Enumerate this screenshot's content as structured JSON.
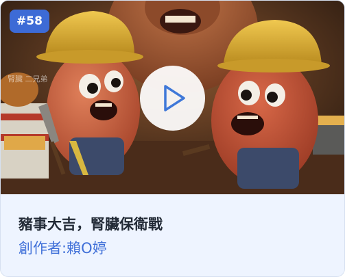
{
  "card": {
    "badge": "#58",
    "title": "豬事大吉，腎臟保衛戰",
    "author": "創作者:賴O婷",
    "watermark": "腎臟  二兄弟"
  },
  "colors": {
    "badge_bg": "#3d6bd6",
    "author_text": "#3f6fd8",
    "play_icon": "#3f78d8",
    "info_bg": "#eef4ff"
  },
  "icons": {
    "play": "play-icon"
  }
}
